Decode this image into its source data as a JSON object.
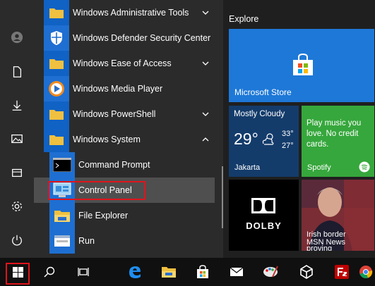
{
  "apps": [
    {
      "label": "Windows Administrative Tools",
      "has_chevron": true
    },
    {
      "label": "Windows Defender Security Center"
    },
    {
      "label": "Windows Ease of Access",
      "has_chevron": true
    },
    {
      "label": "Windows Media Player"
    },
    {
      "label": "Windows PowerShell",
      "has_chevron": true
    },
    {
      "label": "Windows System",
      "expanded": true
    },
    {
      "label": "Command Prompt"
    },
    {
      "label": "Control Panel",
      "selected": true
    },
    {
      "label": "File Explorer"
    },
    {
      "label": "Run"
    }
  ],
  "tiles": {
    "group_title": "Explore",
    "store": {
      "label": "Microsoft Store"
    },
    "weather": {
      "condition": "Mostly Cloudy",
      "temp": "29°",
      "high": "33°",
      "low": "27°",
      "city": "Jakarta"
    },
    "spotify": {
      "text": "Play music you love. No credit cards.",
      "label": "Spotify"
    },
    "dolby": {
      "label": "DOLBY"
    },
    "news": {
      "headline1": "Irish border",
      "headline2": "MSN News",
      "headline3": "proving"
    }
  },
  "colors": {
    "accent": "#1e78d7",
    "highlight": "#e0141b",
    "folder": "#f0c040"
  }
}
